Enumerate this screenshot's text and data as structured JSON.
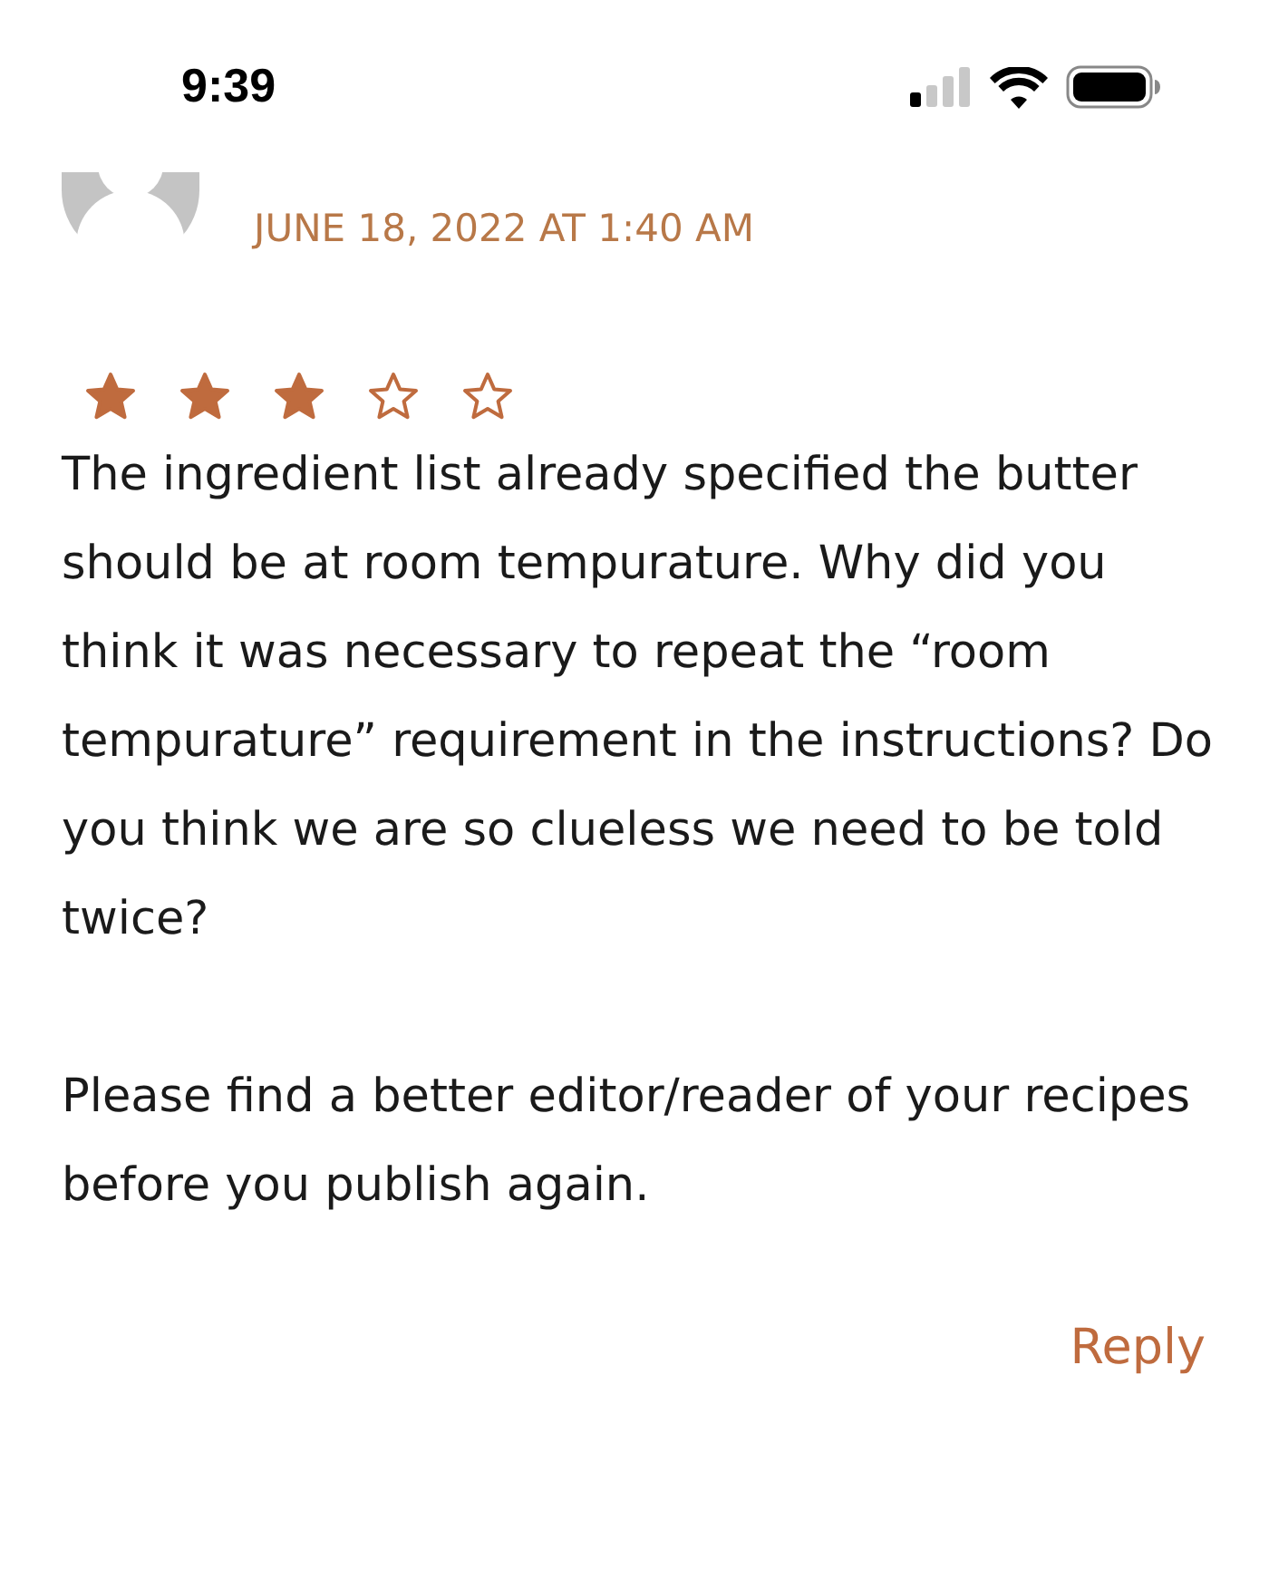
{
  "status_bar": {
    "time": "9:39"
  },
  "comment": {
    "date": "JUNE 18, 2022 AT 1:40 AM",
    "stars": 3,
    "paragraphs": [
      "The ingredient list already specified the butter should be at room tempurature. Why did you think it was necessary to repeat the “room tempurature” requirement in the instructions? Do you think we are so clueless we need to be told twice?",
      "Please find a better editor/reader of your recipes before you publish again."
    ],
    "reply": "Reply"
  }
}
